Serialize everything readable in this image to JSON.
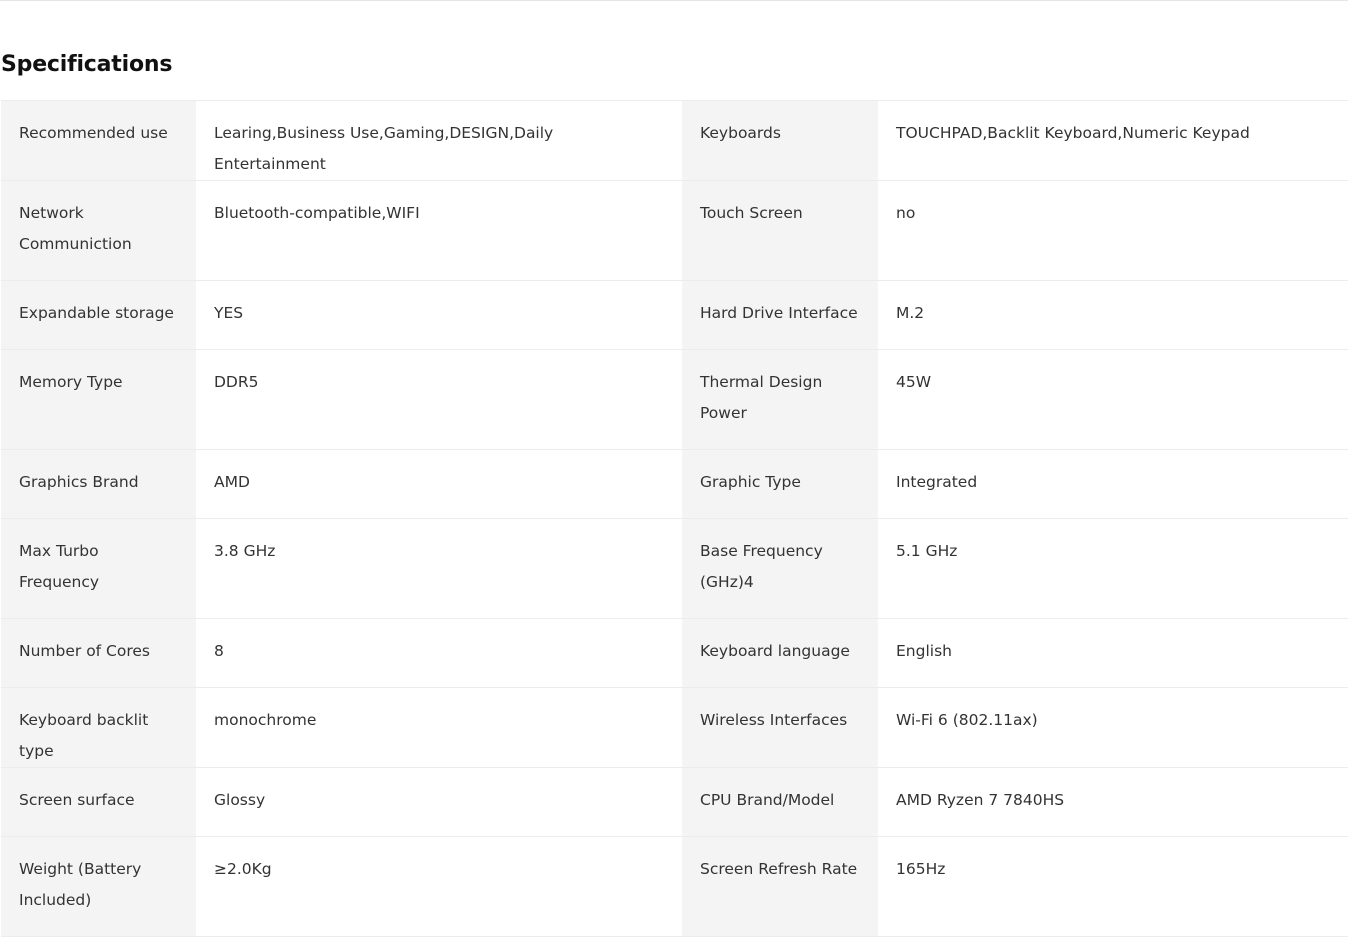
{
  "section": {
    "title": "Specifications"
  },
  "specs": [
    {
      "l1": "Recommended use",
      "v1": "Learing,Business Use,Gaming,DESIGN,Daily Entertainment",
      "l2": "Keyboards",
      "v2": "TOUCHPAD,Backlit Keyboard,Numeric Keypad"
    },
    {
      "l1": "Network Communiction",
      "v1": "Bluetooth-compatible,WIFI",
      "l2": "Touch Screen",
      "v2": "no"
    },
    {
      "l1": "Expandable storage",
      "v1": "YES",
      "l2": "Hard Drive Interface",
      "v2": "M.2"
    },
    {
      "l1": "Memory Type",
      "v1": "DDR5",
      "l2": "Thermal Design Power",
      "v2": "45W"
    },
    {
      "l1": "Graphics Brand",
      "v1": "AMD",
      "l2": "Graphic Type",
      "v2": "Integrated"
    },
    {
      "l1": "Max Turbo Frequency",
      "v1": "3.8 GHz",
      "l2": "Base Frequency (GHz)4",
      "v2": "5.1 GHz"
    },
    {
      "l1": "Number of Cores",
      "v1": "8",
      "l2": "Keyboard language",
      "v2": "English"
    },
    {
      "l1": "Keyboard backlit type",
      "v1": "monochrome",
      "l2": "Wireless Interfaces",
      "v2": "Wi-Fi 6 (802.11ax)"
    },
    {
      "l1": "Screen surface",
      "v1": "Glossy",
      "l2": "CPU Brand/Model",
      "v2": "AMD Ryzen 7 7840HS"
    },
    {
      "l1": "Weight (Battery Included)",
      "v1": "≥2.0Kg",
      "l2": "Screen Refresh Rate",
      "v2": "165Hz"
    }
  ]
}
